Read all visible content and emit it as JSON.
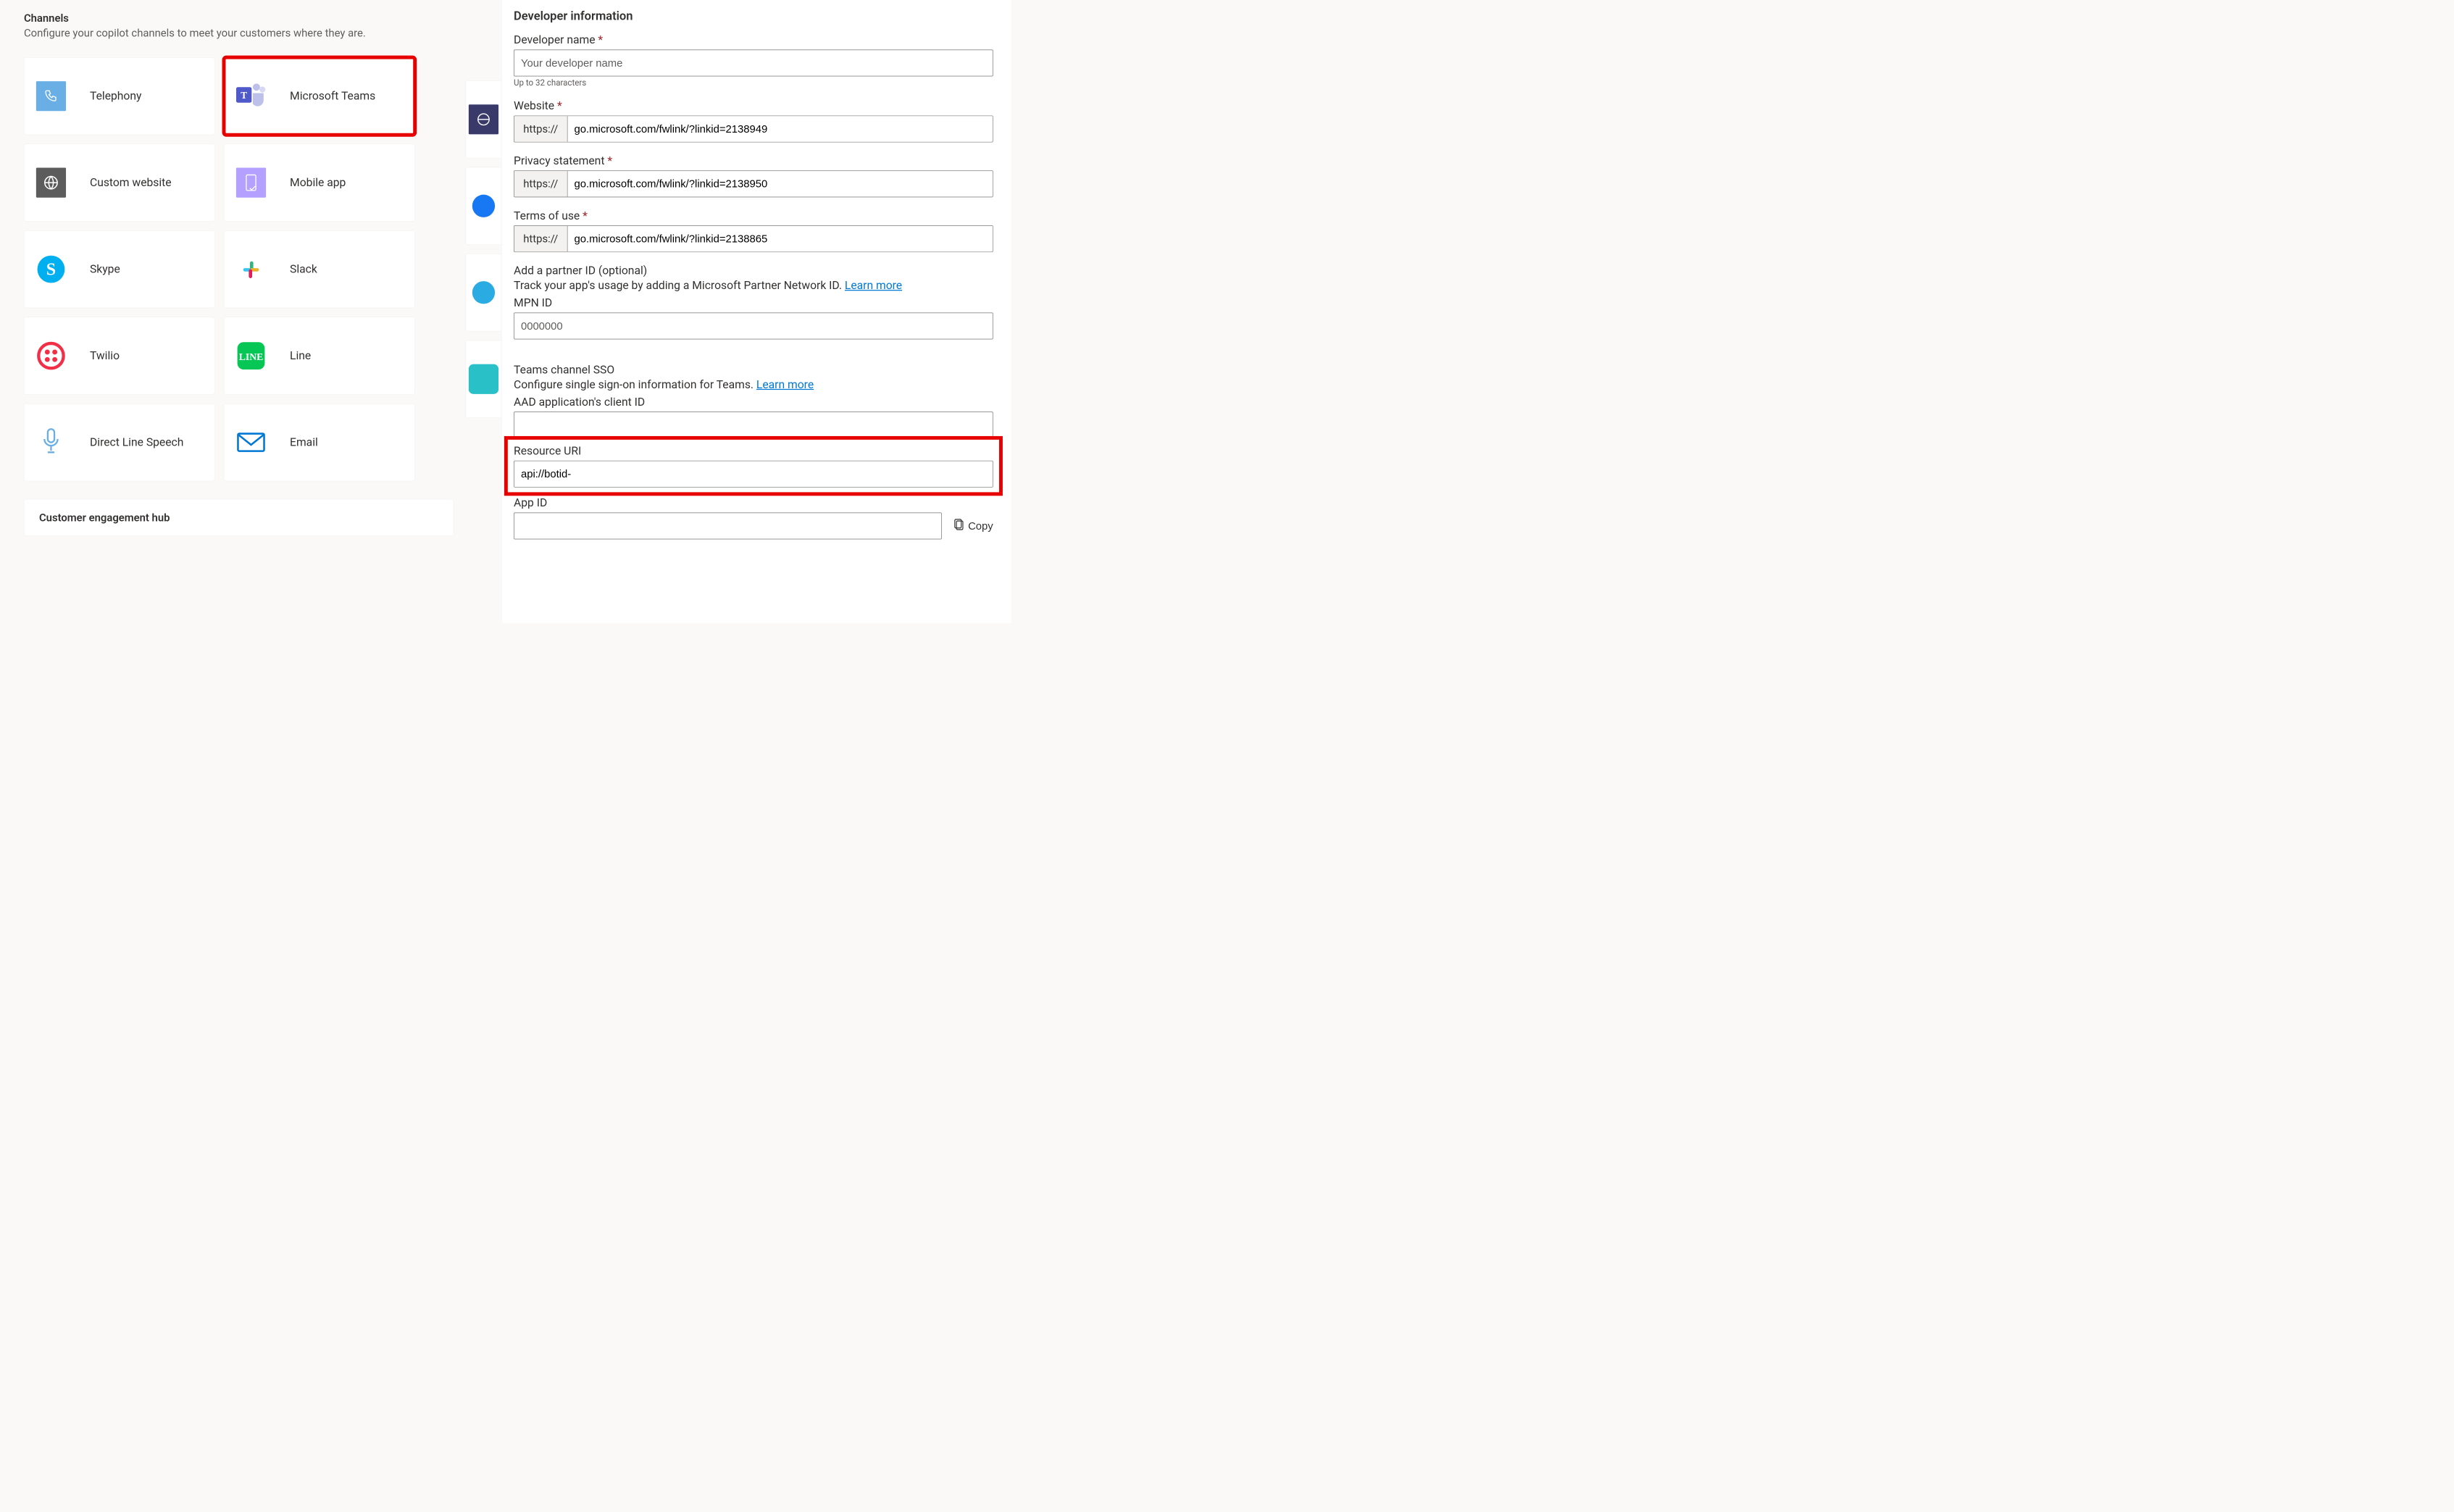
{
  "channels": {
    "title": "Channels",
    "subtitle": "Configure your copilot channels to meet your customers where they are.",
    "items": [
      {
        "label": "Telephony"
      },
      {
        "label": "Microsoft Teams"
      },
      {
        "label": "Custom website"
      },
      {
        "label": "Mobile app"
      },
      {
        "label": "Skype"
      },
      {
        "label": "Slack"
      },
      {
        "label": "Twilio"
      },
      {
        "label": "Line"
      },
      {
        "label": "Direct Line Speech"
      },
      {
        "label": "Email"
      }
    ],
    "engagement_hub_title": "Customer engagement hub"
  },
  "devinfo": {
    "section": "Developer information",
    "dev_name_label": "Developer name",
    "dev_name_placeholder": "Your developer name",
    "dev_name_help": "Up to 32 characters",
    "website_label": "Website",
    "website_prefix": "https://",
    "website_value": "go.microsoft.com/fwlink/?linkid=2138949",
    "privacy_label": "Privacy statement",
    "privacy_value": "go.microsoft.com/fwlink/?linkid=2138950",
    "terms_label": "Terms of use",
    "terms_value": "go.microsoft.com/fwlink/?linkid=2138865",
    "partner_head": "Add a partner ID (optional)",
    "partner_desc": "Track your app's usage by adding a Microsoft Partner Network ID. ",
    "learn_more": "Learn more",
    "mpn_label": "MPN ID",
    "mpn_placeholder": "0000000",
    "sso_head": "Teams channel SSO",
    "sso_desc": "Configure single sign-on information for Teams. ",
    "aad_label": "AAD application's client ID",
    "resource_label": "Resource URI",
    "resource_value": "api://botid-",
    "appid_label": "App ID",
    "copy_label": "Copy"
  }
}
